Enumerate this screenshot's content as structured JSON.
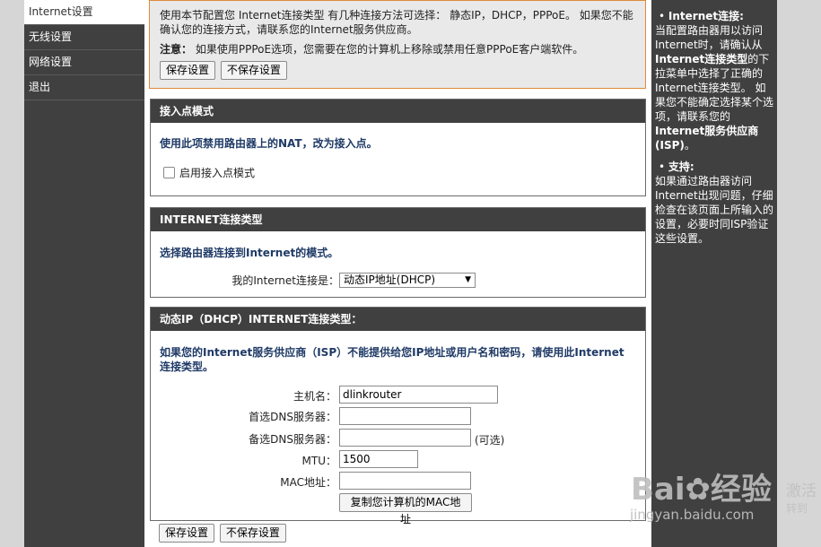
{
  "nav": {
    "items": [
      {
        "label": "Internet设置",
        "active": true
      },
      {
        "label": "无线设置",
        "active": false
      },
      {
        "label": "网络设置",
        "active": false
      },
      {
        "label": "退出",
        "active": false
      }
    ]
  },
  "notice": {
    "text": "使用本节配置您 Internet连接类型 有几种连接方法可选择： 静态IP，DHCP，PPPoE。 如果您不能确认您的连接方式，请联系您的Internet服务供应商。",
    "note_label": "注意：",
    "note_text": "如果使用PPPoE选项，您需要在您的计算机上移除或禁用任意PPPoE客户端软件。",
    "save_label": "保存设置",
    "nosave_label": "不保存设置"
  },
  "ap_mode": {
    "title": "接入点模式",
    "desc": "使用此项禁用路由器上的NAT，改为接入点。",
    "checkbox_label": "启用接入点模式"
  },
  "conn_type": {
    "title": "INTERNET连接类型",
    "desc": "选择路由器连接到Internet的模式。",
    "field_label": "我的Internet连接是：",
    "selected": "动态IP地址(DHCP)"
  },
  "dhcp": {
    "title": "动态IP（DHCP）INTERNET连接类型：",
    "desc": "如果您的Internet服务供应商（ISP）不能提供给您IP地址或用户名和密码，请使用此Internet连接类型。",
    "hostname_label": "主机名：",
    "hostname_value": "dlinkrouter",
    "dns1_label": "首选DNS服务器：",
    "dns1_value": "",
    "dns2_label": "备选DNS服务器：",
    "dns2_value": "",
    "optional": "(可选)",
    "mtu_label": "MTU：",
    "mtu_value": "1500",
    "mac_label": "MAC地址：",
    "mac_value": "",
    "clone_mac_label": "复制您计算机的MAC地址"
  },
  "bottom": {
    "save_label": "保存设置",
    "nosave_label": "不保存设置"
  },
  "help": {
    "h1": "Internet连接:",
    "t1a": "当配置路由器用以访问Internet时，请确认从",
    "t1b": "Internet连接类型",
    "t1c": "的下拉菜单中选择了正确的Internet连接类型。 如果您不能确定选择某个选项，请联系您的",
    "t1d": "Internet服务供应商(ISP)",
    "t1e": "。",
    "h2": "支持:",
    "t2": "如果通过路由器访问Internet出现问题，仔细检查在该页面上所输入的设置，必要时同ISP验证这些设置。"
  },
  "watermark": {
    "brand": "Bai",
    "brand2": "经验",
    "url": "jingyan.baidu.com",
    "side1": "激活",
    "side2": "转到"
  }
}
